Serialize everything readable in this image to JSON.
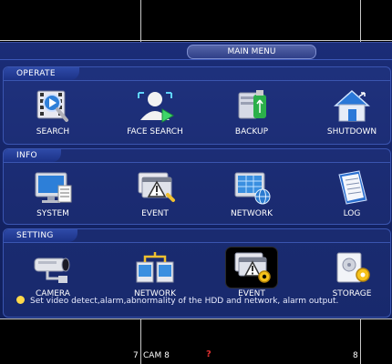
{
  "menu_title": "MAIN MENU",
  "sections": {
    "operate": {
      "title": "OPERATE",
      "items": [
        {
          "label": "SEARCH",
          "icon": "film-search-icon"
        },
        {
          "label": "FACE SEARCH",
          "icon": "face-search-icon"
        },
        {
          "label": "BACKUP",
          "icon": "usb-backup-icon"
        },
        {
          "label": "SHUTDOWN",
          "icon": "shutdown-house-icon"
        }
      ]
    },
    "info": {
      "title": "INFO",
      "items": [
        {
          "label": "SYSTEM",
          "icon": "monitor-info-icon"
        },
        {
          "label": "EVENT",
          "icon": "event-warning-icon"
        },
        {
          "label": "NETWORK",
          "icon": "network-globe-icon"
        },
        {
          "label": "LOG",
          "icon": "log-book-icon"
        }
      ]
    },
    "setting": {
      "title": "SETTING",
      "items": [
        {
          "label": "CAMERA",
          "icon": "cctv-camera-icon"
        },
        {
          "label": "NETWORK",
          "icon": "network-switch-icon"
        },
        {
          "label": "EVENT",
          "icon": "event-gear-icon",
          "selected": true
        },
        {
          "label": "STORAGE",
          "icon": "hdd-gear-icon"
        }
      ]
    }
  },
  "tip": "Set video detect,alarm,abnormality of the HDD and network, alarm output.",
  "background": {
    "cam7": "7",
    "cam8": "CAM 8",
    "warn": "?",
    "cam8_num": "8"
  },
  "colors": {
    "menu_bg": "#142364",
    "section_border": "#3a55b0",
    "accent_yellow": "#ffd94a",
    "warning_red": "#e03030"
  }
}
